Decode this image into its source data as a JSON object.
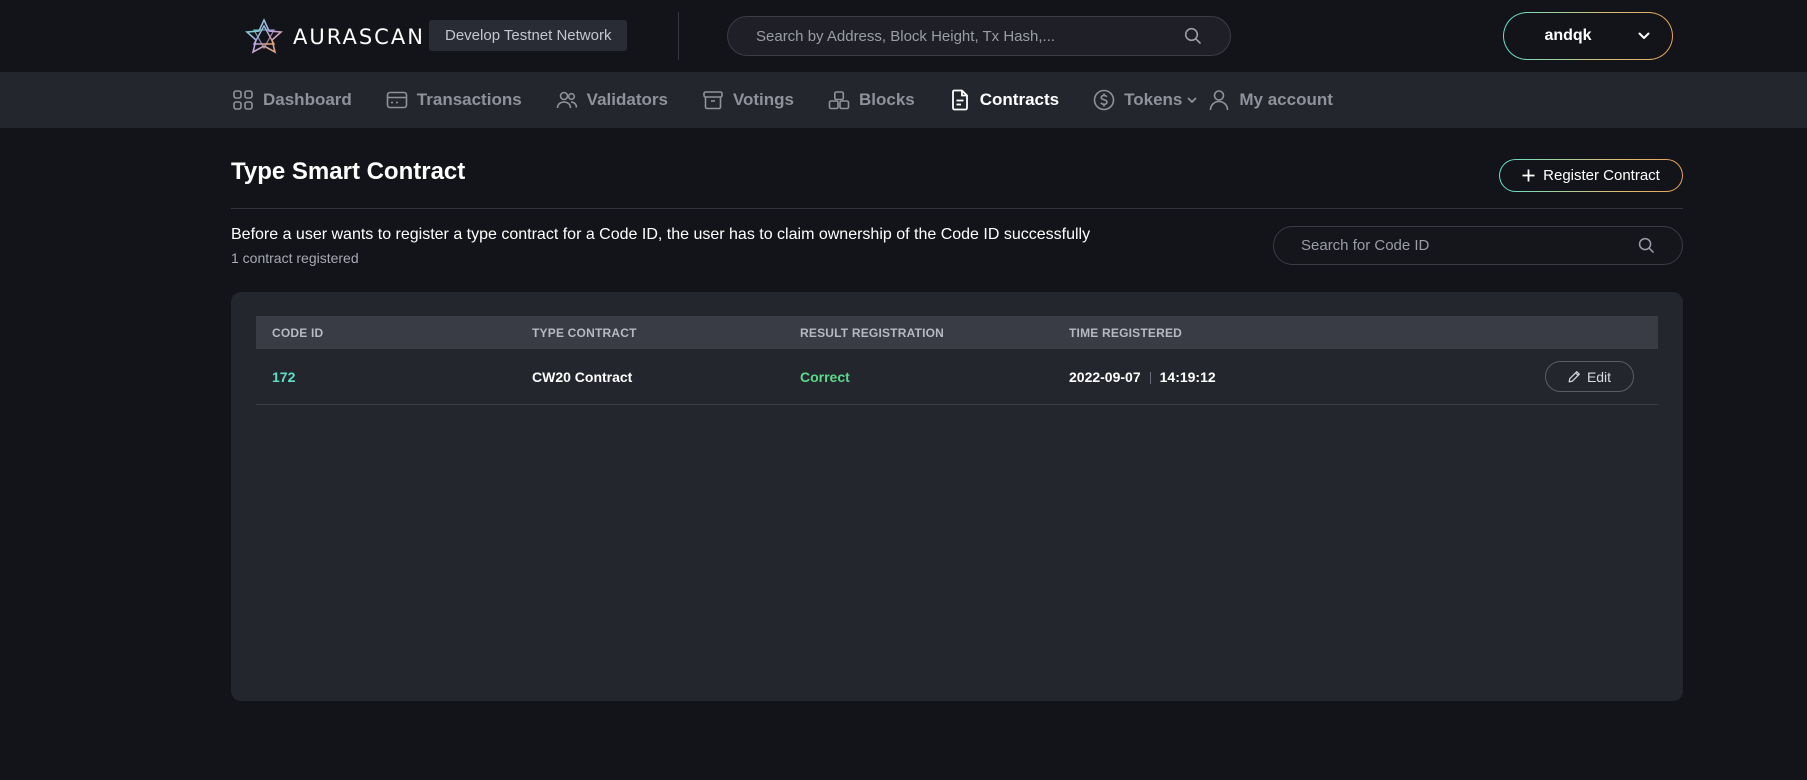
{
  "header": {
    "logo_text": "AURASCAN",
    "network_label": "Develop Testnet Network",
    "search_placeholder": "Search by Address, Block Height, Tx Hash,...",
    "account_name": "andqk"
  },
  "nav": {
    "items": [
      {
        "label": "Dashboard",
        "icon": "dashboard-icon"
      },
      {
        "label": "Transactions",
        "icon": "transactions-icon"
      },
      {
        "label": "Validators",
        "icon": "validators-icon"
      },
      {
        "label": "Votings",
        "icon": "votings-icon"
      },
      {
        "label": "Blocks",
        "icon": "blocks-icon"
      },
      {
        "label": "Contracts",
        "icon": "contracts-icon",
        "active": true
      },
      {
        "label": "Tokens",
        "icon": "tokens-icon",
        "dropdown": true
      },
      {
        "label": "My account",
        "icon": "account-icon"
      }
    ]
  },
  "page": {
    "title": "Type Smart Contract",
    "register_label": "Register Contract",
    "description": "Before a user wants to register a type contract for a Code ID, the user has to claim ownership of the Code ID successfully",
    "count_text": "1 contract registered",
    "code_search_placeholder": "Search for Code ID"
  },
  "table": {
    "columns": [
      "CODE ID",
      "TYPE CONTRACT",
      "RESULT REGISTRATION",
      "TIME REGISTERED"
    ],
    "rows": [
      {
        "code_id": "172",
        "type_contract": "CW20 Contract",
        "result": "Correct",
        "date": "2022-09-07",
        "time": "14:19:12",
        "action_label": "Edit"
      }
    ]
  },
  "colors": {
    "accent_teal": "#5ee0c8",
    "accent_orange": "#e6a15a",
    "success_green": "#5bd98a",
    "background": "#131419",
    "surface": "#24262d"
  }
}
